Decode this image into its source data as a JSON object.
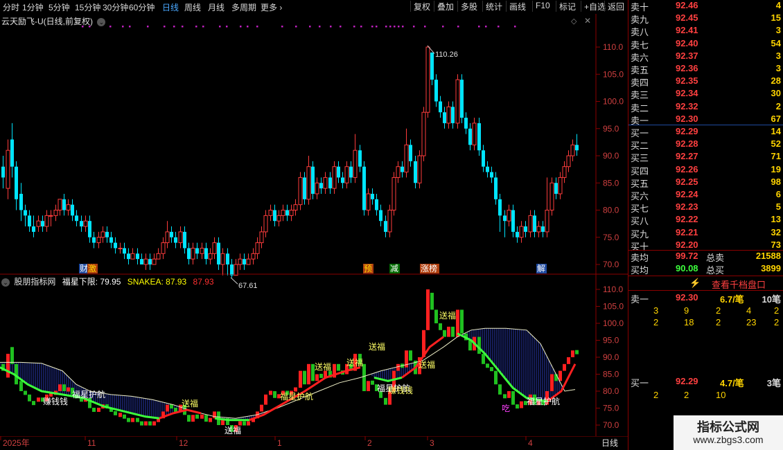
{
  "toolbar": {
    "periods": [
      "分时",
      "1分钟",
      "5分钟",
      "15分钟",
      "30分钟",
      "60分钟",
      "日线",
      "周线",
      "月线",
      "多周期",
      "更多"
    ],
    "selected": "日线",
    "actions": [
      "复权",
      "叠加",
      "多股",
      "统计",
      "画线",
      "F10",
      "标记",
      "+自选",
      "返回"
    ]
  },
  "main_chart": {
    "title": "云天励飞-U(日线,前复权)",
    "y_ticks": [
      "110.0",
      "105.0",
      "100.0",
      "95.0",
      "90.0",
      "85.0",
      "80.0",
      "75.0",
      "70.0"
    ],
    "high_label": "110.26",
    "low_label": "67.61",
    "event_tags": [
      {
        "text": "财"
      },
      {
        "text": "激"
      },
      {
        "text": "预"
      },
      {
        "text": "减"
      },
      {
        "text": "涨榜"
      },
      {
        "text": "解"
      }
    ]
  },
  "indicator": {
    "name": "股朋指标网",
    "line1_label": "福星下限",
    "line1_value": "79.95",
    "line2_label": "SNAKEA",
    "line2_value": "87.93",
    "line3_value": "87.93",
    "y_ticks": [
      "110.0",
      "105.0",
      "100.0",
      "95.0",
      "90.0",
      "85.0",
      "80.0",
      "75.0",
      "70.0"
    ],
    "annotations": [
      "赚钱钱",
      "福星护航",
      "送福",
      "送福",
      "福星护航",
      "送福",
      "送福",
      "送福",
      "福星护航",
      "赚钱钱",
      "送福",
      "送福",
      "福星护航",
      "吃"
    ]
  },
  "time_axis": {
    "labels": [
      "2025年",
      "11",
      "12",
      "1",
      "2",
      "3",
      "4"
    ],
    "period": "日线"
  },
  "quote": {
    "asks": [
      {
        "name": "卖十",
        "price": "92.46",
        "vol": "4"
      },
      {
        "name": "卖九",
        "price": "92.45",
        "vol": "15"
      },
      {
        "name": "卖八",
        "price": "92.41",
        "vol": "3"
      },
      {
        "name": "卖七",
        "price": "92.40",
        "vol": "54"
      },
      {
        "name": "卖六",
        "price": "92.37",
        "vol": "3"
      },
      {
        "name": "卖五",
        "price": "92.36",
        "vol": "3"
      },
      {
        "name": "卖四",
        "price": "92.35",
        "vol": "28"
      },
      {
        "name": "卖三",
        "price": "92.34",
        "vol": "30"
      },
      {
        "name": "卖二",
        "price": "92.32",
        "vol": "2"
      },
      {
        "name": "卖一",
        "price": "92.30",
        "vol": "67"
      }
    ],
    "bids": [
      {
        "name": "买一",
        "price": "92.29",
        "vol": "14"
      },
      {
        "name": "买二",
        "price": "92.28",
        "vol": "52"
      },
      {
        "name": "买三",
        "price": "92.27",
        "vol": "71"
      },
      {
        "name": "买四",
        "price": "92.26",
        "vol": "19"
      },
      {
        "name": "买五",
        "price": "92.25",
        "vol": "98"
      },
      {
        "name": "买六",
        "price": "92.24",
        "vol": "6"
      },
      {
        "name": "买七",
        "price": "92.23",
        "vol": "5"
      },
      {
        "name": "买八",
        "price": "92.22",
        "vol": "13"
      },
      {
        "name": "买九",
        "price": "92.21",
        "vol": "32"
      },
      {
        "name": "买十",
        "price": "92.20",
        "vol": "73"
      }
    ],
    "avg_sell_label": "卖均",
    "avg_sell": "99.72",
    "total_sell_label": "总卖",
    "total_sell": "21588",
    "avg_buy_label": "买均",
    "avg_buy": "90.08",
    "total_buy_label": "总买",
    "total_buy": "3899",
    "depth_button": "查看千档盘口",
    "sell1": {
      "name": "卖一",
      "price": "92.30",
      "amount": "6.7/笔",
      "count": "10笔",
      "rows": [
        [
          "3",
          "9",
          "2",
          "4",
          "2"
        ],
        [
          "2",
          "18",
          "2",
          "23",
          "2"
        ]
      ]
    },
    "buy1": {
      "name": "买一",
      "price": "92.29",
      "amount": "4.7/笔",
      "count": "3笔",
      "rows": [
        [
          "2",
          "2",
          "10"
        ]
      ]
    },
    "watermark_title": "指标公式网",
    "watermark_url": "www.zbgs3.com"
  }
}
